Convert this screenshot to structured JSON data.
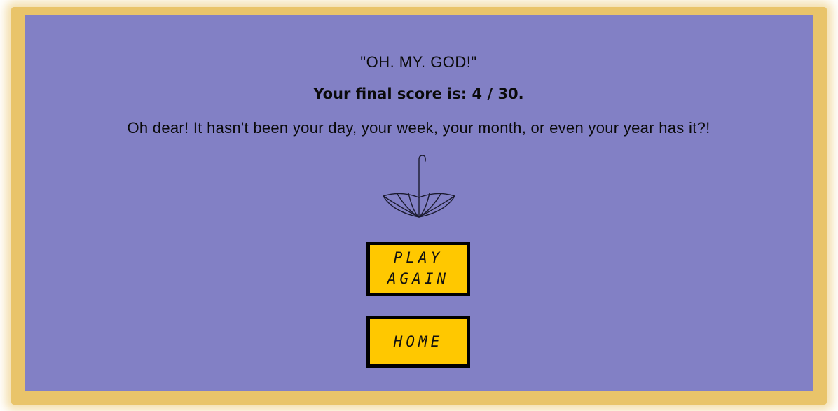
{
  "result": {
    "quote": "\"OH. MY. GOD!\"",
    "score_text": "Your final score is: 4 / 30.",
    "message": "Oh dear! It hasn't been your day, your week, your month, or even your year has it?!"
  },
  "icons": {
    "result_icon": "upside-down-umbrella-icon"
  },
  "buttons": {
    "play_again_line1": "PLAY",
    "play_again_line2": "AGAIN",
    "home": "HOME"
  },
  "colors": {
    "frame": "#e9c46a",
    "panel": "#8280c5",
    "button": "#ffc800",
    "button_border": "#000000"
  }
}
